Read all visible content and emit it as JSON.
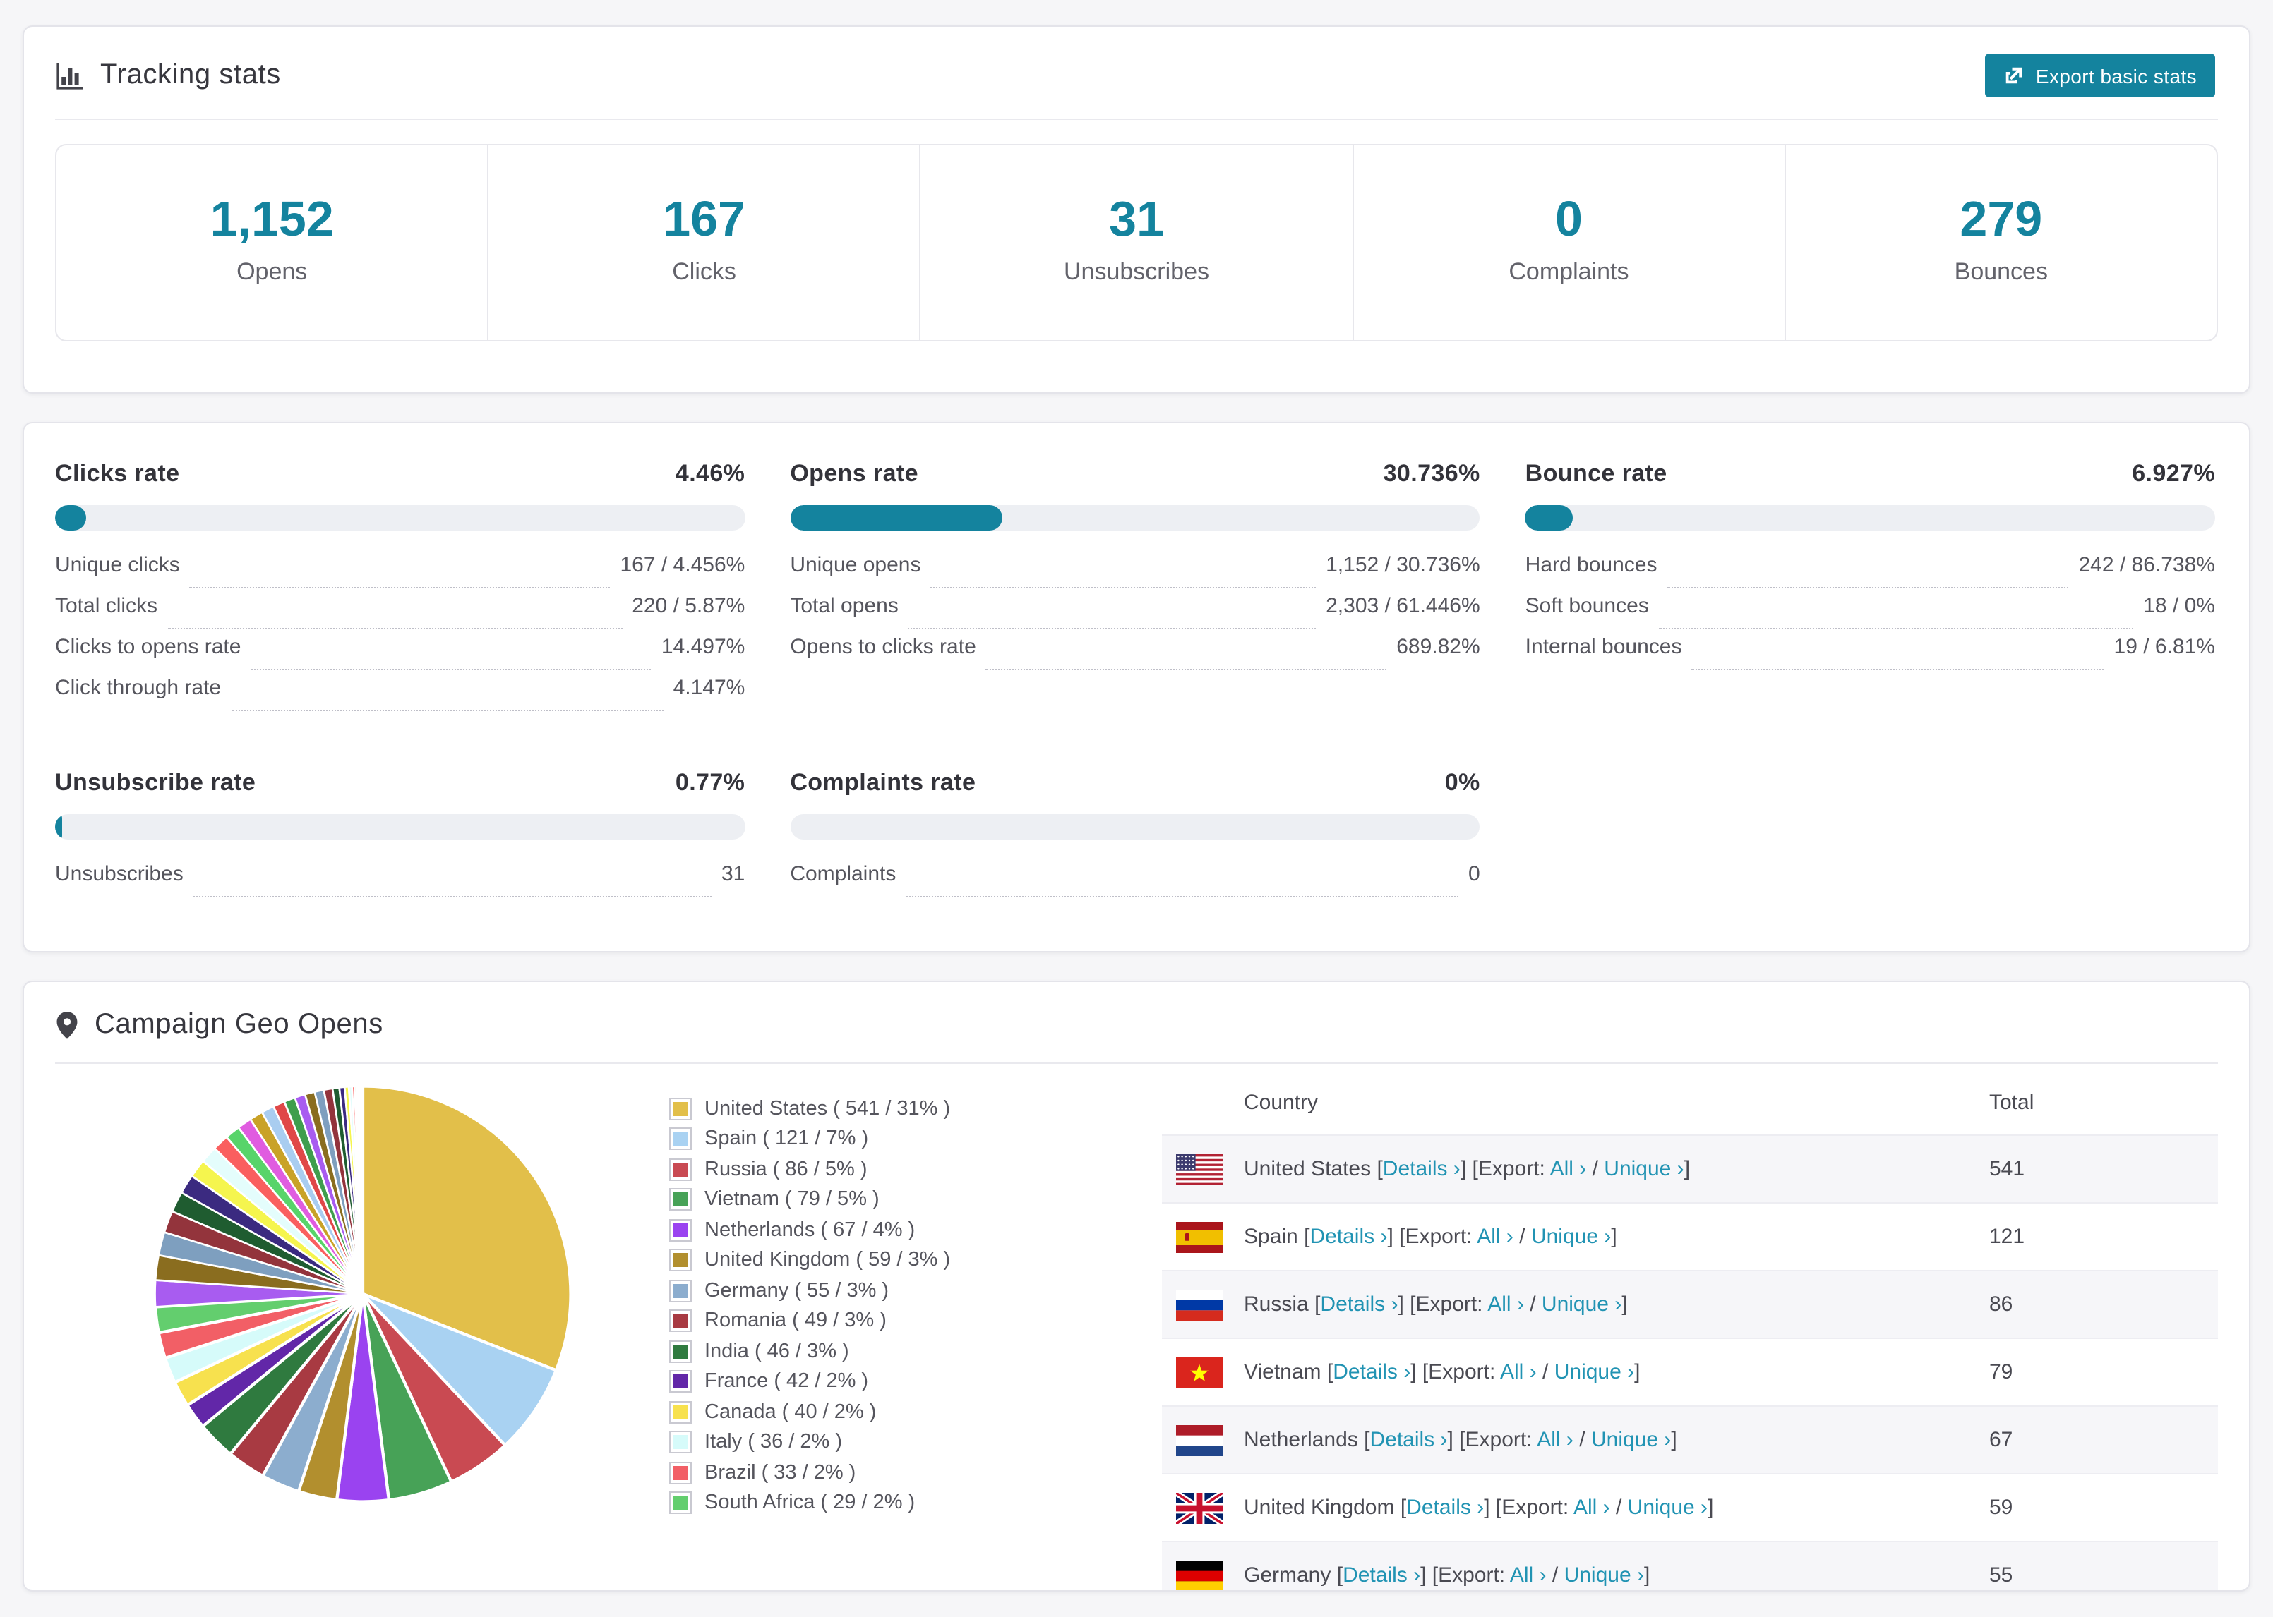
{
  "colors": {
    "accent": "#14839e",
    "link": "#2193b3"
  },
  "tracking": {
    "title": "Tracking stats",
    "export_button": "Export basic stats",
    "summary": [
      {
        "value": "1,152",
        "label": "Opens"
      },
      {
        "value": "167",
        "label": "Clicks"
      },
      {
        "value": "31",
        "label": "Unsubscribes"
      },
      {
        "value": "0",
        "label": "Complaints"
      },
      {
        "value": "279",
        "label": "Bounces"
      }
    ]
  },
  "rates": [
    {
      "title": "Clicks rate",
      "value": "4.46%",
      "pct": 4.46,
      "rows": [
        {
          "label": "Unique clicks",
          "value": "167 / 4.456%"
        },
        {
          "label": "Total clicks",
          "value": "220 / 5.87%"
        },
        {
          "label": "Clicks to opens rate",
          "value": "14.497%"
        },
        {
          "label": "Click through rate",
          "value": "4.147%"
        }
      ]
    },
    {
      "title": "Opens rate",
      "value": "30.736%",
      "pct": 30.736,
      "rows": [
        {
          "label": "Unique opens",
          "value": "1,152 / 30.736%"
        },
        {
          "label": "Total opens",
          "value": "2,303 / 61.446%"
        },
        {
          "label": "Opens to clicks rate",
          "value": "689.82%"
        }
      ]
    },
    {
      "title": "Bounce rate",
      "value": "6.927%",
      "pct": 6.927,
      "rows": [
        {
          "label": "Hard bounces",
          "value": "242 / 86.738%"
        },
        {
          "label": "Soft bounces",
          "value": "18 / 0%"
        },
        {
          "label": "Internal bounces",
          "value": "19 / 6.81%"
        }
      ]
    },
    {
      "title": "Unsubscribe rate",
      "value": "0.77%",
      "pct": 0.77,
      "rows": [
        {
          "label": "Unsubscribes",
          "value": "31"
        }
      ]
    },
    {
      "title": "Complaints rate",
      "value": "0%",
      "pct": 0,
      "rows": [
        {
          "label": "Complaints",
          "value": "0"
        }
      ]
    }
  ],
  "geo": {
    "title": "Campaign Geo Opens",
    "columns": {
      "country": "Country",
      "total": "Total"
    },
    "links": {
      "details": "Details ›",
      "export_prefix": "Export:",
      "all": "All ›",
      "unique": "Unique ›"
    },
    "rows": [
      {
        "flag": "us",
        "country": "United States",
        "total": "541"
      },
      {
        "flag": "es",
        "country": "Spain",
        "total": "121"
      },
      {
        "flag": "ru",
        "country": "Russia",
        "total": "86"
      },
      {
        "flag": "vn",
        "country": "Vietnam",
        "total": "79"
      },
      {
        "flag": "nl",
        "country": "Netherlands",
        "total": "67"
      },
      {
        "flag": "gb",
        "country": "United Kingdom",
        "total": "59"
      },
      {
        "flag": "de",
        "country": "Germany",
        "total": "55"
      }
    ]
  },
  "chart_data": {
    "type": "pie",
    "title": "Campaign Geo Opens",
    "legend_position": "right",
    "series": [
      {
        "name": "United States",
        "count": 541,
        "pct": 31,
        "color": "#e2bf4a"
      },
      {
        "name": "Spain",
        "count": 121,
        "pct": 7,
        "color": "#a9d2f2"
      },
      {
        "name": "Russia",
        "count": 86,
        "pct": 5,
        "color": "#c94a52"
      },
      {
        "name": "Vietnam",
        "count": 79,
        "pct": 5,
        "color": "#47a257"
      },
      {
        "name": "Netherlands",
        "count": 67,
        "pct": 4,
        "color": "#9a43f0"
      },
      {
        "name": "United Kingdom",
        "count": 59,
        "pct": 3,
        "color": "#b28f2e"
      },
      {
        "name": "Germany",
        "count": 55,
        "pct": 3,
        "color": "#8cadce"
      },
      {
        "name": "Romania",
        "count": 49,
        "pct": 3,
        "color": "#a83a42"
      },
      {
        "name": "India",
        "count": 46,
        "pct": 3,
        "color": "#2f7a3f"
      },
      {
        "name": "France",
        "count": 42,
        "pct": 2,
        "color": "#6227a8"
      },
      {
        "name": "Canada",
        "count": 40,
        "pct": 2,
        "color": "#f7e14e"
      },
      {
        "name": "Italy",
        "count": 36,
        "pct": 2,
        "color": "#d6fbfa"
      },
      {
        "name": "Brazil",
        "count": 33,
        "pct": 2,
        "color": "#f25f66"
      },
      {
        "name": "South Africa",
        "count": 29,
        "pct": 2,
        "color": "#63ce6e"
      }
    ],
    "others_unlabeled_pct": 26
  }
}
